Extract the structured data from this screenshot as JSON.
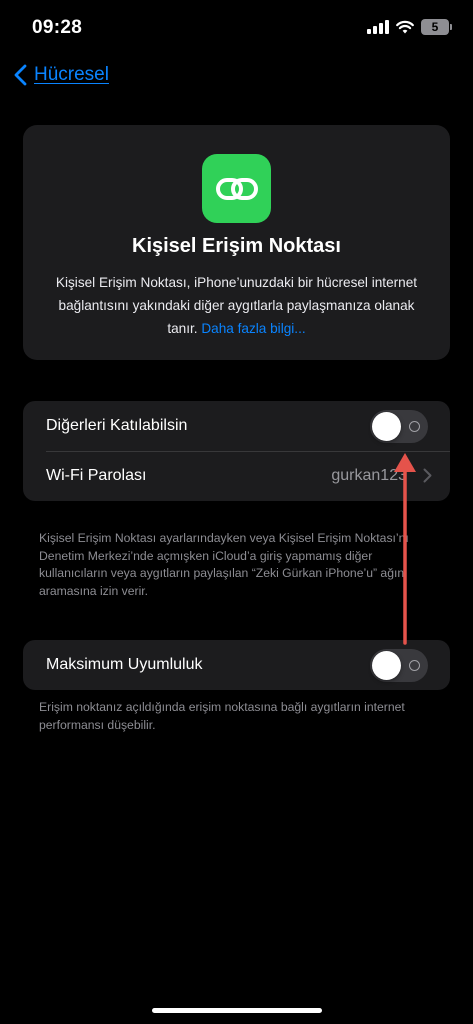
{
  "status_bar": {
    "time": "09:28",
    "battery_level": "5"
  },
  "nav": {
    "back_label": "Hücresel"
  },
  "hero": {
    "title": "Kişisel Erişim Noktası",
    "description": "Kişisel Erişim Noktası, iPhone’unuzdaki bir hücresel internet bağlantısını yakındaki diğer aygıtlarla paylaşmanıza olanak tanır. ",
    "link": "Daha fazla bilgi..."
  },
  "group1": {
    "allow_others": {
      "label": "Diğerleri Katılabilsin",
      "enabled": false
    },
    "wifi_password": {
      "label": "Wi-Fi Parolası",
      "value": "gurkan123"
    }
  },
  "footnote1": "Kişisel Erişim Noktası ayarlarındayken veya Kişisel Erişim Noktası’nı Denetim Merkezi’nde açmışken iCloud’a giriş yapmamış diğer kullanıcıların veya aygıtların paylaşılan “Zeki Gürkan iPhone’u” ağını aramasına izin verir.",
  "group2": {
    "max_compat": {
      "label": "Maksimum Uyumluluk",
      "enabled": false
    }
  },
  "footnote2": "Erişim noktanız açıldığında erişim noktasına bağlı aygıtların internet performansı düşebilir.",
  "colors": {
    "accent": "#0a84ff",
    "hotspot_green": "#30d158",
    "annotation_arrow": "#e5534b",
    "card": "#1c1c1e"
  }
}
